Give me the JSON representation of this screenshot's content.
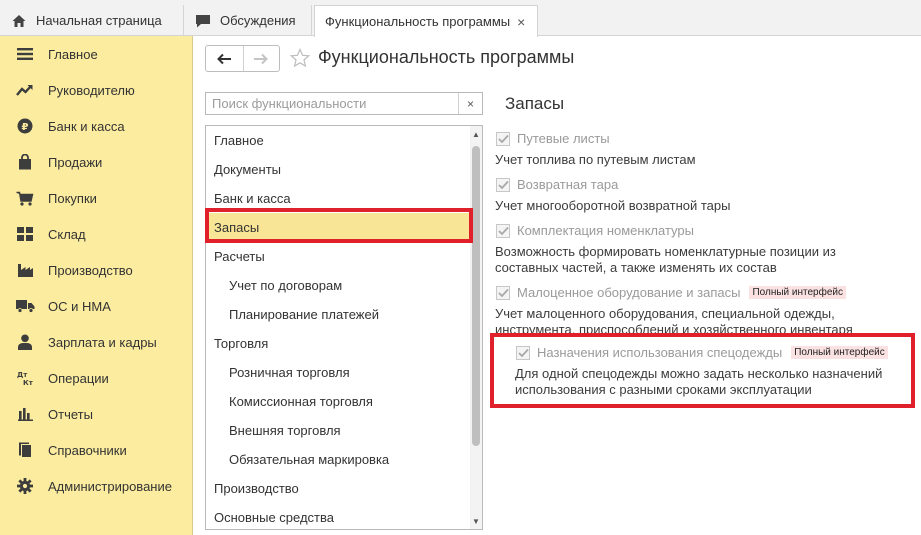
{
  "tabs": {
    "home": "Начальная страница",
    "discussions": "Обсуждения",
    "active": "Функциональность программы",
    "close": "×"
  },
  "sidebar": {
    "items": [
      {
        "label": "Главное",
        "icon": "menu-icon"
      },
      {
        "label": "Руководителю",
        "icon": "trend-up-icon"
      },
      {
        "label": "Банк и касса",
        "icon": "ruble-coin-icon"
      },
      {
        "label": "Продажи",
        "icon": "shopping-bag-icon"
      },
      {
        "label": "Покупки",
        "icon": "cart-icon"
      },
      {
        "label": "Склад",
        "icon": "warehouse-grid-icon"
      },
      {
        "label": "Производство",
        "icon": "factory-icon"
      },
      {
        "label": "ОС и НМА",
        "icon": "truck-icon"
      },
      {
        "label": "Зарплата и кадры",
        "icon": "person-icon"
      },
      {
        "label": "Операции",
        "icon": "dt-kt-icon"
      },
      {
        "label": "Отчеты",
        "icon": "bar-chart-icon"
      },
      {
        "label": "Справочники",
        "icon": "book-icon"
      },
      {
        "label": "Администрирование",
        "icon": "gear-icon"
      }
    ]
  },
  "header": {
    "title": "Функциональность программы",
    "back": "←",
    "forward": "→"
  },
  "search": {
    "placeholder": "Поиск функциональности",
    "clear": "×"
  },
  "sections": [
    {
      "label": "Главное",
      "level": 0
    },
    {
      "label": "Документы",
      "level": 0
    },
    {
      "label": "Банк и касса",
      "level": 0
    },
    {
      "label": "Запасы",
      "level": 0,
      "selected": true
    },
    {
      "label": "Расчеты",
      "level": 0
    },
    {
      "label": "Учет по договорам",
      "level": 1
    },
    {
      "label": "Планирование платежей",
      "level": 1
    },
    {
      "label": "Торговля",
      "level": 0
    },
    {
      "label": "Розничная торговля",
      "level": 1
    },
    {
      "label": "Комиссионная торговля",
      "level": 1
    },
    {
      "label": "Внешняя торговля",
      "level": 1
    },
    {
      "label": "Обязательная маркировка",
      "level": 1
    },
    {
      "label": "Производство",
      "level": 0
    },
    {
      "label": "Основные средства",
      "level": 0
    }
  ],
  "panel": {
    "title": "Запасы",
    "badge": "Полный интерфейс",
    "options": [
      {
        "label": "Путевые листы",
        "checked": true,
        "desc": "Учет топлива по путевым листам"
      },
      {
        "label": "Возвратная тара",
        "checked": true,
        "desc": "Учет многооборотной возвратной тары"
      },
      {
        "label": "Комплектация номенклатуры",
        "checked": true,
        "desc": "Возможность формировать номенклатурные позиции из составных частей, а также изменять их состав"
      },
      {
        "label": "Малоценное оборудование и запасы",
        "checked": true,
        "badge": "Полный интерфейс",
        "desc": "Учет малоценного оборудования, специальной одежды, инструмента, приспособлений и хозяйственного инвентаря"
      },
      {
        "label": "Назначения использования спецодежды",
        "checked": true,
        "badge": "Полный интерфейс",
        "desc": "Для одной спецодежды можно задать несколько назначений использования с разными сроками эксплуатации"
      }
    ]
  },
  "colors": {
    "sidebar_bg": "#fbec9f",
    "selected_row": "#f9e596",
    "highlight_frame": "#e0202a",
    "badge_bg": "#fbe2e2"
  }
}
